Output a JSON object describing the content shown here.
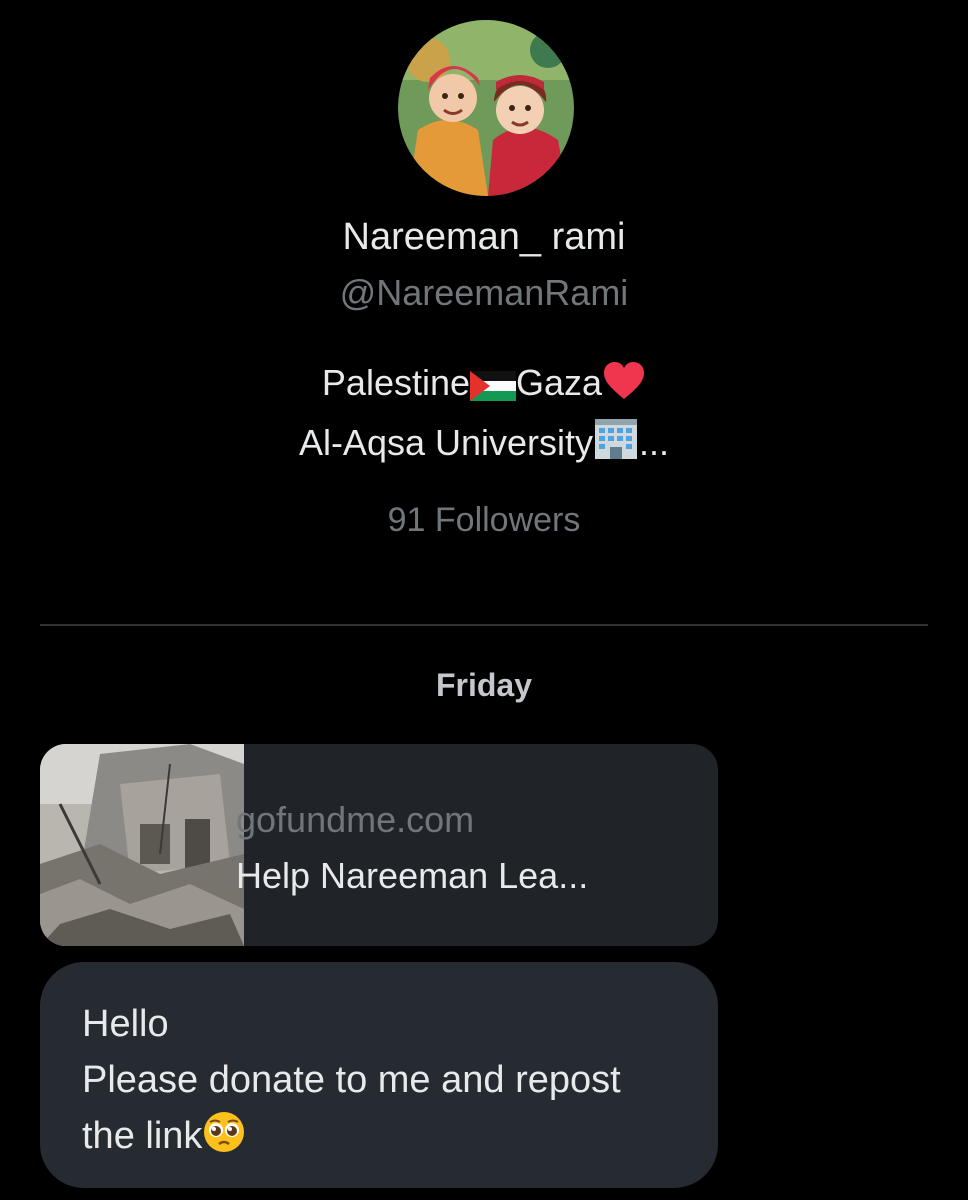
{
  "profile": {
    "display_name": "Nareeman_ rami",
    "handle": "@NareemanRami",
    "bio_line1_a": "Palestine",
    "bio_line1_b": "Gaza",
    "bio_line2": "Al-Aqsa University",
    "bio_line2_ellipsis": "...",
    "followers_text": "91 Followers",
    "icons": [
      "palestine-flag-emoji",
      "red-heart-emoji",
      "office-building-emoji"
    ]
  },
  "conversation": {
    "day_label": "Friday",
    "link_card": {
      "domain": "gofundme.com",
      "title": "Help Nareeman Lea..."
    },
    "message": {
      "line1": "Hello",
      "line2": "Please donate to me and repost",
      "line3": "the link",
      "emoji": "pleading-face-emoji"
    }
  },
  "colors": {
    "background": "#000000",
    "primary_text": "#e7e9ea",
    "secondary_text": "#71767b",
    "bubble": "#252b31",
    "card": "#202327"
  }
}
